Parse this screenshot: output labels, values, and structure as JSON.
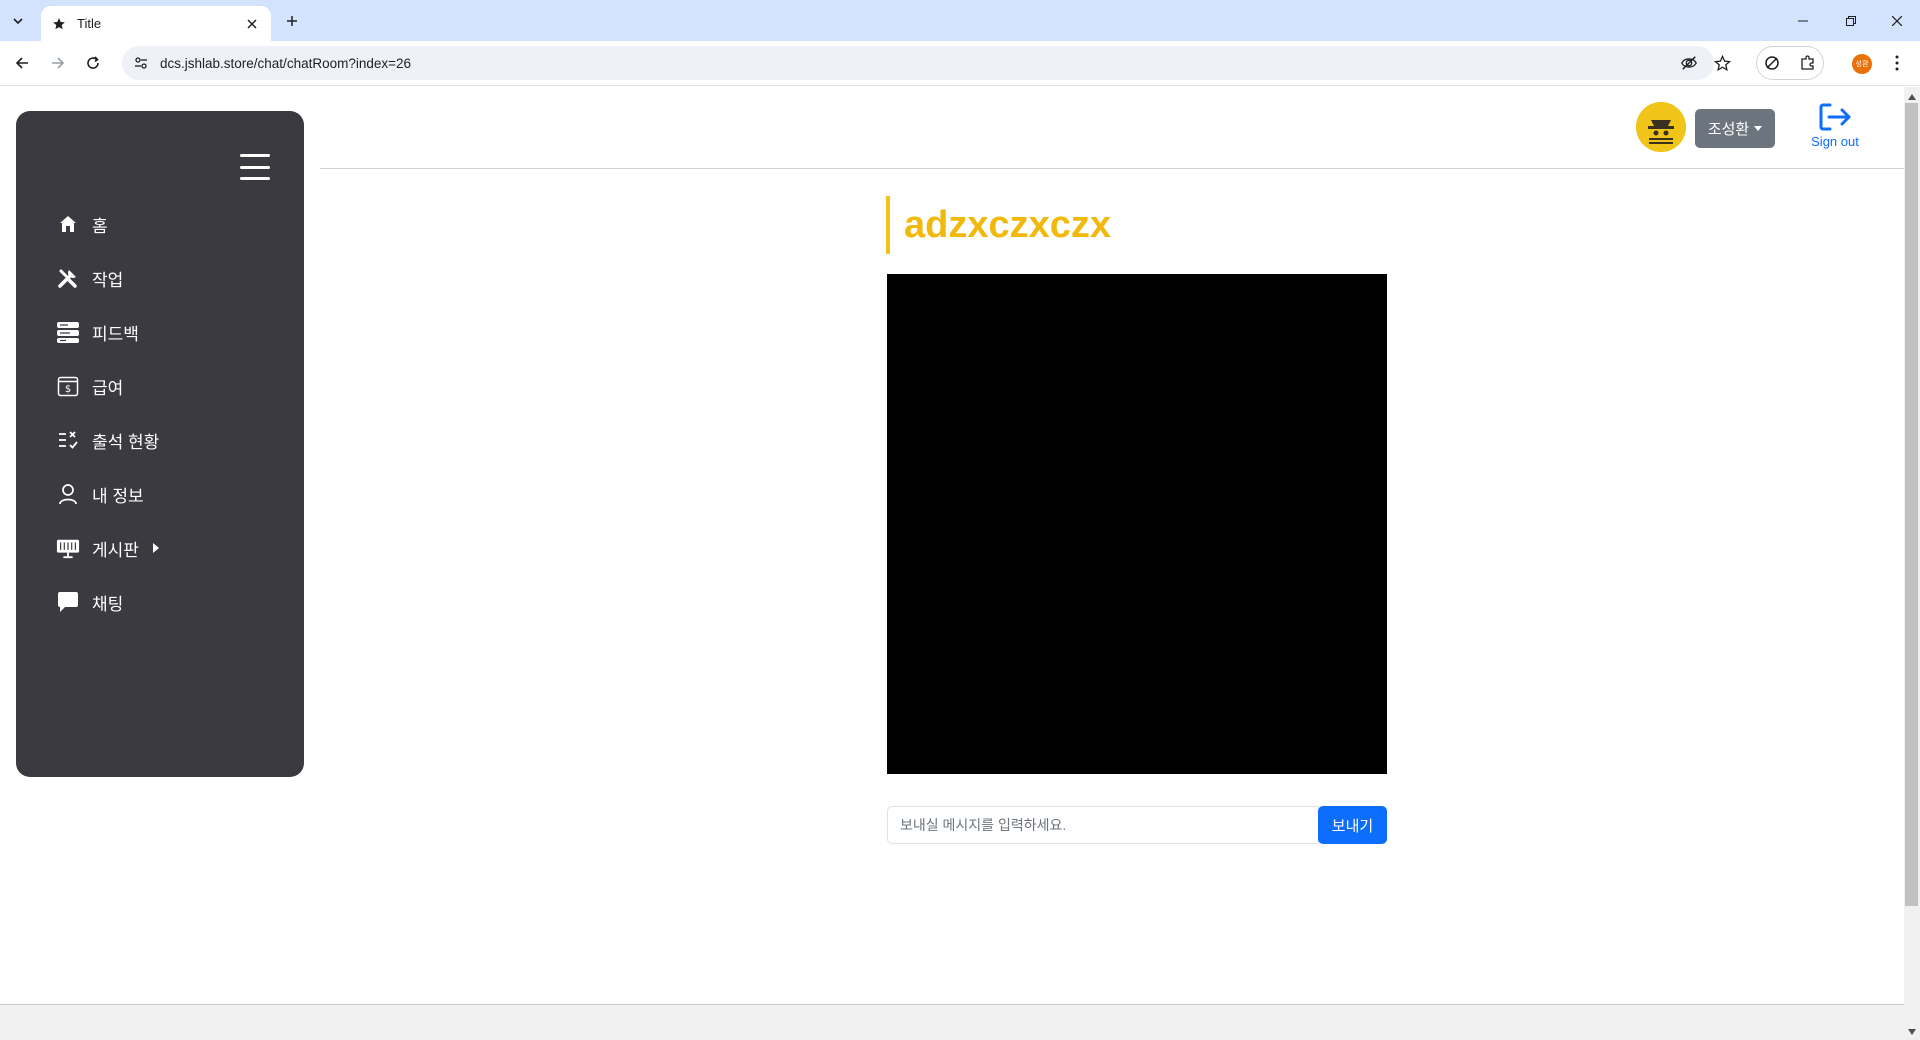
{
  "browser": {
    "tab_title": "Title",
    "url": "dcs.jshlab.store/chat/chatRoom?index=26",
    "profile_initials": "성환"
  },
  "sidebar": {
    "items": [
      {
        "label": "홈",
        "icon": "home-icon"
      },
      {
        "label": "작업",
        "icon": "tools-icon"
      },
      {
        "label": "피드백",
        "icon": "feedback-icon"
      },
      {
        "label": "급여",
        "icon": "salary-icon"
      },
      {
        "label": "출석 현황",
        "icon": "attendance-icon"
      },
      {
        "label": "내 정보",
        "icon": "person-icon"
      },
      {
        "label": "게시판",
        "icon": "board-icon",
        "has_submenu": true
      },
      {
        "label": "채팅",
        "icon": "chat-icon"
      }
    ]
  },
  "header": {
    "user_name": "조성환",
    "signout_label": "Sign out"
  },
  "chat": {
    "room_title": "adzxczxczx",
    "input_placeholder": "보내실 메시지를 입력하세요.",
    "send_label": "보내기"
  },
  "colors": {
    "sidebar_bg": "#3a3a40",
    "title_accent": "#f0b90b",
    "primary": "#0d6efd",
    "secondary": "#6c757d"
  }
}
